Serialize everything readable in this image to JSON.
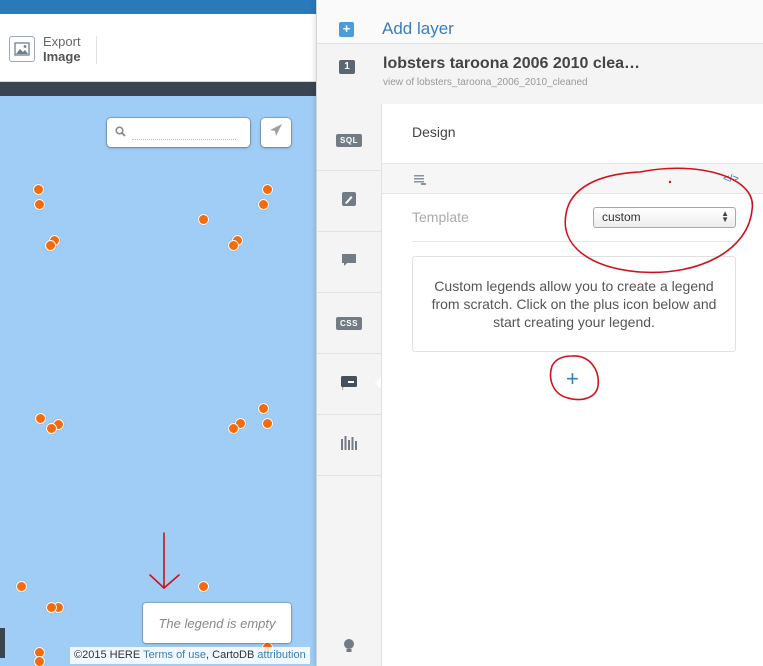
{
  "toolbar": {
    "export_line1": "Export",
    "export_line2": "Image"
  },
  "map": {
    "search_placeholder": "",
    "legend_empty": "The legend is empty",
    "attribution": {
      "copyright": "©2015 HERE",
      "terms": "Terms of use",
      "separator": ", CartoDB",
      "attribution_link": "attribution"
    },
    "point_color": "#f46a0c"
  },
  "panel": {
    "add_layer": "Add layer",
    "layer_number": "1",
    "layer_title": "lobsters taroona 2006 2010 clea…",
    "layer_subtitle": "view of lobsters_taroona_2006_2010_cleaned",
    "tabs": [
      {
        "name": "sql",
        "label": "SQL"
      },
      {
        "name": "wizard",
        "label": ""
      },
      {
        "name": "infowindow",
        "label": ""
      },
      {
        "name": "css",
        "label": "CSS"
      },
      {
        "name": "legends",
        "label": ""
      },
      {
        "name": "filters",
        "label": ""
      }
    ],
    "design": {
      "title": "Design",
      "code_link": "</>",
      "template_label": "Template",
      "template_value": "custom",
      "info": "Custom legends allow you to create a legend from scratch. Click on the plus icon below and start creating your legend.",
      "plus": "+"
    }
  },
  "colors": {
    "accent": "#397dba",
    "map_bg": "#9fcdf6",
    "annotation": "#d0121b"
  }
}
